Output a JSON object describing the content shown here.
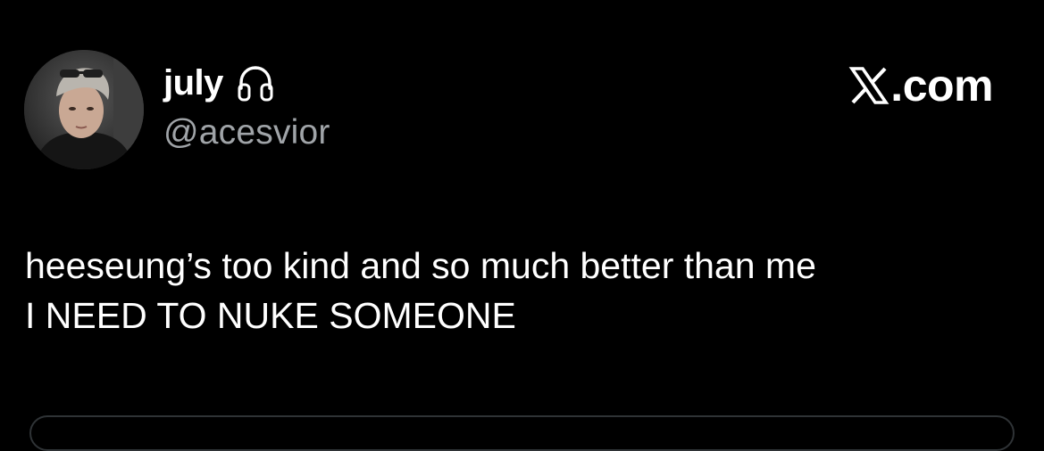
{
  "tweet": {
    "author": {
      "display_name": "july",
      "handle": "@acesvior",
      "badge_icon": "headphones-icon"
    },
    "brand": {
      "icon": "x-logo-icon",
      "text": ".com"
    },
    "body_lines": [
      "heeseung’s too kind and so much better than me",
      "I NEED TO NUKE SOMEONE"
    ]
  },
  "colors": {
    "background": "#000000",
    "text_primary": "#ffffff",
    "text_secondary": "#a0a4a8",
    "border": "#2f3336"
  }
}
